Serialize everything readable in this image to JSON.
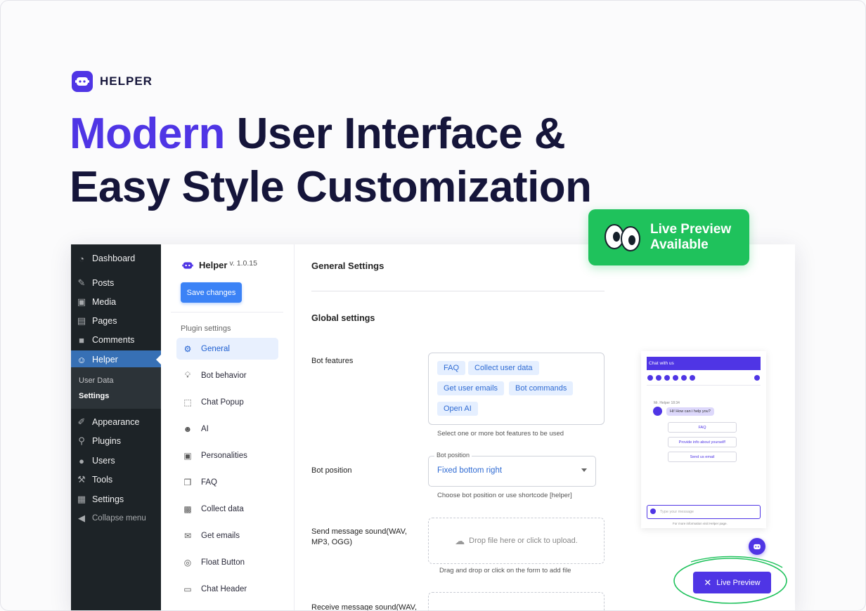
{
  "brand": {
    "name": "HELPER"
  },
  "headline": {
    "accent": "Modern",
    "line1_rest": " User Interface &",
    "line2": "Easy Style Customization"
  },
  "badge": {
    "line1": "Live Preview",
    "line2": "Available"
  },
  "wp_sidebar": {
    "items": [
      {
        "label": "Dashboard",
        "icon": "dashboard-icon"
      },
      {
        "label": "Posts",
        "icon": "pin-icon"
      },
      {
        "label": "Media",
        "icon": "media-icon"
      },
      {
        "label": "Pages",
        "icon": "pages-icon"
      },
      {
        "label": "Comments",
        "icon": "comment-icon"
      },
      {
        "label": "Helper",
        "icon": "bot-icon"
      },
      {
        "label": "Appearance",
        "icon": "brush-icon"
      },
      {
        "label": "Plugins",
        "icon": "plug-icon"
      },
      {
        "label": "Users",
        "icon": "user-icon"
      },
      {
        "label": "Tools",
        "icon": "wrench-icon"
      },
      {
        "label": "Settings",
        "icon": "sliders-icon"
      },
      {
        "label": "Collapse menu",
        "icon": "collapse-icon"
      }
    ],
    "submenu": [
      "User Data",
      "Settings"
    ]
  },
  "plugin_nav": {
    "title": "Helper",
    "version": "v. 1.0.15",
    "save_label": "Save changes",
    "section": "Plugin settings",
    "items": [
      {
        "label": "General",
        "icon": "gear-icon"
      },
      {
        "label": "Bot behavior",
        "icon": "bulb-icon"
      },
      {
        "label": "Chat Popup",
        "icon": "popup-icon"
      },
      {
        "label": "AI",
        "icon": "robot-icon"
      },
      {
        "label": "Personalities",
        "icon": "id-card-icon"
      },
      {
        "label": "FAQ",
        "icon": "quiz-icon"
      },
      {
        "label": "Collect data",
        "icon": "save-icon"
      },
      {
        "label": "Get emails",
        "icon": "mail-icon"
      },
      {
        "label": "Float Button",
        "icon": "tap-icon"
      },
      {
        "label": "Chat Header",
        "icon": "window-icon"
      }
    ]
  },
  "main": {
    "title": "General Settings",
    "section": "Global settings",
    "bot_features": {
      "label": "Bot features",
      "chips": [
        "FAQ",
        "Collect user data",
        "Get user emails",
        "Bot commands",
        "Open AI"
      ],
      "helper": "Select one or more bot features to be used"
    },
    "bot_position": {
      "label": "Bot position",
      "legend": "Bot position",
      "value": "Fixed bottom right",
      "helper": "Choose bot position or use shortcode [helper]"
    },
    "send_sound": {
      "label": "Send message sound(WAV, MP3, OGG)",
      "drop_text": "Drop file here or click to upload.",
      "helper": "Drag and drop or click on the form to add file"
    },
    "receive_sound": {
      "label": "Receive message sound(WAV,"
    }
  },
  "chat_preview": {
    "header": "Chat with us",
    "meta": "Mr. Helper 18:34",
    "message": "Hi! How can i help you?",
    "options": [
      "FAQ",
      "Provide info about yourself!",
      "Send us email"
    ],
    "input_placeholder": "Type your message",
    "footer": "For more information visit Helper page.",
    "live_preview_label": "Live Preview"
  },
  "colors": {
    "accent": "#4f35e5",
    "wp_sidebar": "#1d2327",
    "wp_active": "#3770b5",
    "badge": "#1fc25c",
    "save_button": "#3b82f6"
  }
}
